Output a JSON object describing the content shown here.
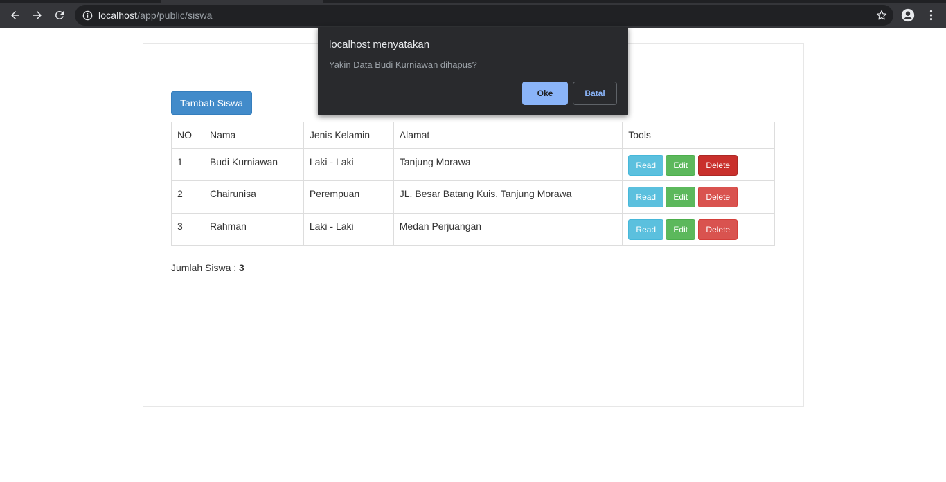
{
  "browser": {
    "url_host": "localhost",
    "url_path": "/app/public/siswa",
    "icons": [
      "back-icon",
      "forward-icon",
      "reload-icon",
      "info-icon",
      "star-icon",
      "profile-icon",
      "menu-icon"
    ]
  },
  "page": {
    "add_button_label": "Tambah Siswa",
    "table": {
      "headers": [
        "NO",
        "Nama",
        "Jenis Kelamin",
        "Alamat",
        "Tools"
      ],
      "rows": [
        {
          "no": "1",
          "nama": "Budi Kurniawan",
          "jenis_kelamin": "Laki - Laki",
          "alamat": "Tanjung Morawa"
        },
        {
          "no": "2",
          "nama": "Chairunisa",
          "jenis_kelamin": "Perempuan",
          "alamat": "JL. Besar Batang Kuis, Tanjung Morawa"
        },
        {
          "no": "3",
          "nama": "Rahman",
          "jenis_kelamin": "Laki - Laki",
          "alamat": "Medan Perjuangan"
        }
      ],
      "actions": {
        "read": "Read",
        "edit": "Edit",
        "delete": "Delete"
      }
    },
    "total_label": "Jumlah Siswa : ",
    "total_value": "3"
  },
  "dialog": {
    "title": "localhost menyatakan",
    "message": "Yakin Data Budi Kurniawan dihapus?",
    "ok_label": "Oke",
    "cancel_label": "Batal"
  },
  "colors": {
    "primary": "#428bca",
    "info": "#5bc0de",
    "success": "#5cb85c",
    "danger": "#d9534f",
    "danger_active": "#c9302c",
    "dialog_bg": "#292a2d",
    "dialog_accent": "#8ab4f8"
  }
}
